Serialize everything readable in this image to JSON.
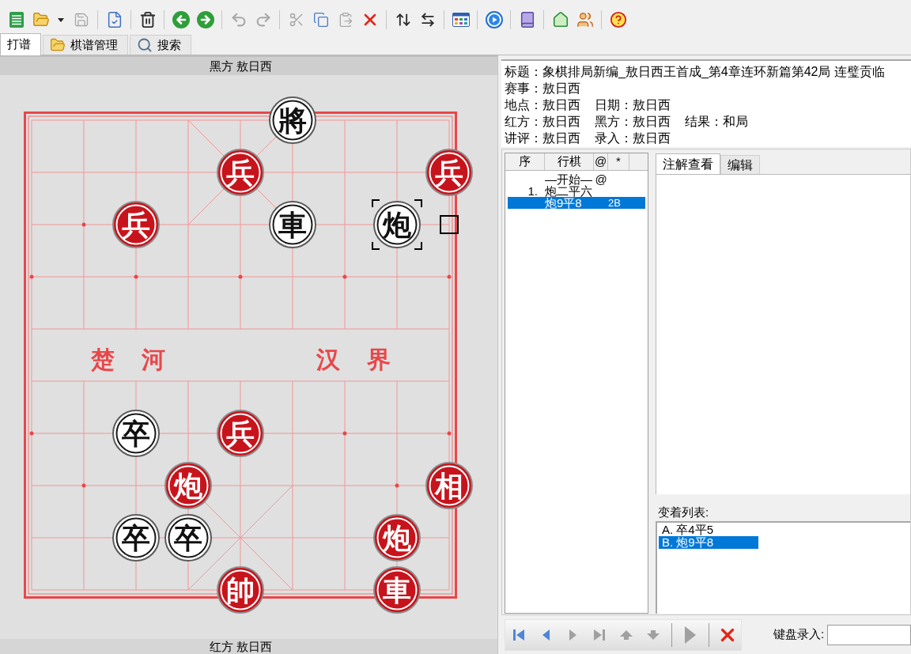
{
  "toolbar": [
    [
      {
        "kind": "list",
        "disabled": false
      },
      {
        "kind": "open",
        "disabled": false
      },
      {
        "kind": "dropdown",
        "disabled": false
      },
      {
        "kind": "save",
        "disabled": true
      }
    ],
    [
      {
        "kind": "edit",
        "disabled": false
      }
    ],
    [
      {
        "kind": "trash",
        "disabled": false
      }
    ],
    [
      {
        "kind": "back",
        "disabled": false
      },
      {
        "kind": "forward",
        "disabled": false
      }
    ],
    [
      {
        "kind": "undo",
        "disabled": true
      },
      {
        "kind": "redo",
        "disabled": true
      }
    ],
    [
      {
        "kind": "cut",
        "disabled": true
      },
      {
        "kind": "copy",
        "disabled": false
      },
      {
        "kind": "paste",
        "disabled": true
      },
      {
        "kind": "delete",
        "disabled": false
      }
    ],
    [
      {
        "kind": "flip",
        "disabled": false
      },
      {
        "kind": "swap",
        "disabled": false
      }
    ],
    [
      {
        "kind": "grid",
        "disabled": false
      }
    ],
    [
      {
        "kind": "play",
        "disabled": false
      }
    ],
    [
      {
        "kind": "book",
        "disabled": false
      }
    ],
    [
      {
        "kind": "home",
        "disabled": false
      },
      {
        "kind": "users",
        "disabled": false
      }
    ],
    [
      {
        "kind": "help",
        "disabled": false
      }
    ]
  ],
  "tabs": [
    {
      "label": "打谱",
      "selected": true
    },
    {
      "label": "棋谱管理",
      "selected": false
    },
    {
      "label": "搜索",
      "selected": false
    }
  ],
  "board": {
    "top_label": "黑方 敖日西",
    "river": [
      "楚 河",
      "汉 界"
    ],
    "pieces": [
      {
        "kind": "black",
        "label": "將",
        "selected": false
      },
      {
        "kind": "red",
        "label": "兵",
        "selected": false
      },
      {
        "kind": "red",
        "label": "兵",
        "selected": false
      },
      {
        "kind": "red",
        "label": "兵",
        "selected": false
      },
      {
        "kind": "black",
        "label": "車",
        "selected": false
      },
      {
        "kind": "black",
        "label": "炮",
        "selected": true
      },
      {
        "kind": "black",
        "label": "卒",
        "selected": false
      },
      {
        "kind": "red",
        "label": "兵",
        "selected": false
      },
      {
        "kind": "red",
        "label": "炮",
        "selected": false
      },
      {
        "kind": "red",
        "label": "相",
        "selected": false
      },
      {
        "kind": "black",
        "label": "卒",
        "selected": false
      },
      {
        "kind": "black",
        "label": "卒",
        "selected": false
      },
      {
        "kind": "red",
        "label": "炮",
        "selected": false
      },
      {
        "kind": "red",
        "label": "帥",
        "selected": false
      },
      {
        "kind": "red",
        "label": "車",
        "selected": false
      }
    ],
    "last_move_marker": true,
    "bottom_label": "红方 敖日西"
  },
  "info": [
    [
      "标题：象棋排局新编_敖日西王首成_第4章连环新篇第42局 连璧贡临"
    ],
    [
      "赛事：敖日西"
    ],
    [
      "地点：敖日西",
      "日期：敖日西"
    ],
    [
      "红方：敖日西",
      "黑方：敖日西",
      "结果：和局"
    ],
    [
      "讲评：敖日西",
      "录入：敖日西"
    ]
  ],
  "move_list": {
    "columns": [
      "序",
      "行棋",
      "@",
      "*"
    ],
    "rows": [
      {
        "move": "—开始—",
        "mark": "@",
        "selected": false
      },
      {
        "number": "1.",
        "move": "炮二平六",
        "selected": false
      },
      {
        "move": "炮9平8",
        "note": "2B",
        "selected": true
      }
    ]
  },
  "comment_tabs": [
    {
      "label": "注解查看",
      "selected": true
    },
    {
      "label": "编辑",
      "selected": false
    }
  ],
  "variations": {
    "label": "变着列表:",
    "items": [
      {
        "label": "A. 卒4平5",
        "selected": false
      },
      {
        "label": "B. 炮9平8",
        "selected": true
      }
    ]
  },
  "nav": [
    [
      {
        "kind": "first",
        "disabled": false
      },
      {
        "kind": "prev",
        "disabled": false
      },
      {
        "kind": "next",
        "disabled": true
      },
      {
        "kind": "last",
        "disabled": true
      },
      {
        "kind": "up",
        "disabled": true
      },
      {
        "kind": "down",
        "disabled": true
      }
    ],
    [
      {
        "kind": "play",
        "disabled": true
      }
    ],
    [
      {
        "kind": "delete",
        "disabled": false
      }
    ]
  ],
  "keyboard_entry": {
    "label": "键盘录入:"
  }
}
